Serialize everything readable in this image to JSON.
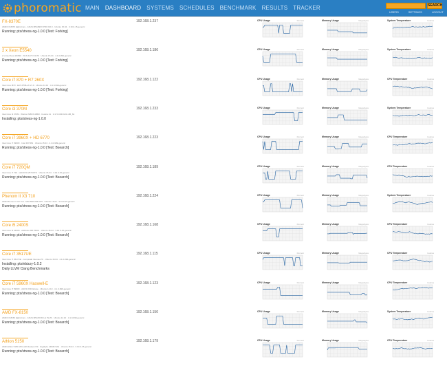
{
  "header": {
    "logo_text": "phoromatic",
    "nav": [
      "MAIN",
      "DASHBOARD",
      "SYSTEMS",
      "SCHEDULES",
      "BENCHMARK",
      "RESULTS",
      "TRACKER"
    ],
    "active_nav": "DASHBOARD",
    "search_button": "SEARCH",
    "user_links": [
      "USERS",
      "SETTINGS",
      "LOGOUT"
    ]
  },
  "graph_titles": [
    "CPU Usage",
    "Memory Usage",
    "System Temperature"
  ],
  "graph_titles_alt": [
    "CPU Usage",
    "Memory Usage",
    "CPU Temperature"
  ],
  "graph_units": [
    "Percent",
    "Megabytes",
    "Celsius"
  ],
  "systems": [
    {
      "name": "FX-8370E",
      "spec": "AMD FX-8370 Eight-Core · ASUS M5A99FX PRO R2.0 · Ubuntu 15.04 · 3.19.0-15-generic",
      "status": "Running: pts/stress-ng-1.0.0 [Test: Forking]",
      "status2": "",
      "ip": "192.168.1.237",
      "temp_title": "System Temperature"
    },
    {
      "name": "2 x Xeon E5540",
      "spec": "2 x Intel Xeon E5540 · SUN 4170 X4170 · Ubuntu 15.04 · 4.1.0-999-generic",
      "status": "Running: pts/stress-ng-1.0.0 [Test: Forking]",
      "status2": "",
      "ip": "192.168.1.186",
      "temp_title": "System Temperature"
    },
    {
      "name": "Core i7 870 + R7 260X",
      "spec": "Intel Core i870 · ECS P55H-A V1.0 · Ubuntu 14.10 · 4.1.0-999-generic",
      "status": "Running: pts/stress-ng-1.0.0 [Test: Forking]",
      "status2": "",
      "ip": "192.168.1.122",
      "temp_title": "CPU Temperature"
    },
    {
      "name": "Core i3 370M",
      "spec": "Intel Core i3 370M · Wistron MBXX-MBM · Fedora 21 · 3.17.8-300.fc21.x86_64",
      "status": "Installing: pts/stress-ng-1.0.0",
      "status2": "",
      "ip": "192.168.1.233",
      "temp_title": "System Temperature"
    },
    {
      "name": "Core i7 3960X + HD 6770",
      "spec": "Intel Core i7 3960X · Intel DX79SI · Ubuntu 15.04 · 4.1.0-999-generic",
      "status": "Running: pts/stress-ng-1.0.0 [Test: Bsearch]",
      "status2": "",
      "ip": "192.168.1.223",
      "temp_title": "CPU Temperature"
    },
    {
      "name": "Core i7 720QM",
      "spec": "Intel Core i7 720 · LENOVO 2574CTO · Ubuntu 15.04 · 3.19.0-15-generic",
      "status": "Running: pts/stress-ng-1.0.0 [Test: Bsearch]",
      "status2": "",
      "ip": "192.168.1.189",
      "temp_title": "CPU Temperature"
    },
    {
      "name": "Phenom II X3 710",
      "spec": "AMD Phenom II X3 710 · MSI 890GXM-G65 · Ubuntu 15.04 · 3.19.0-15-generic",
      "status": "Running: pts/stress-ng-1.0.0 [Test: Bsearch]",
      "status2": "",
      "ip": "192.168.1.224",
      "temp_title": "System Temperature"
    },
    {
      "name": "Core i5 2400S",
      "spec": "Intel Core i5 2400S · ASRock Z68 PRO3 · Ubuntu 15.04 · 3.19.0-15-generic",
      "status": "Running: pts/stress-ng-1.0.0 [Test: Bsearch]",
      "status2": "",
      "ip": "192.168.1.168",
      "temp_title": "CPU Temperature"
    },
    {
      "name": "Core i7 3517UE",
      "spec": "Intel Core i7 3517UE · Compulab Intense-PC · Ubuntu 15.04 · 4.1.0-999-generic",
      "status": "Installing: pts/ebizzy-1.0.2",
      "status2": "Daily LLVM Clang Benchmarks",
      "ip": "192.168.1.115",
      "temp_title": "CPU Temperature"
    },
    {
      "name": "Core i7 5960X Haswell-E",
      "spec": "Intel Core i7 5960X · ASUS X99 Deluxe · Ubuntu 14.10 · 4.1.0-999-generic",
      "status": "Running: pts/stress-ng-1.0.0 [Test: Bsearch]",
      "status2": "",
      "ip": "192.168.1.123",
      "temp_title": "CPU Temperature"
    },
    {
      "name": "AMD FX-8150",
      "spec": "AMD FX-8150 Eight-Core · ASUS M5A 88-M LE PLUS · Ubuntu 14.10 · 4.1.0-999-generic",
      "status": "Running: pts/stress-ng-1.0.0 [Test: Bsearch]",
      "status2": "",
      "ip": "192.168.1.150",
      "temp_title": "System Temperature"
    },
    {
      "name": "Athlon 5150",
      "spec": "AMD Athlon 5150 APU with Radeon R3 · Gigabyte AM1M-S2H · Ubuntu 15.04 · 3.19.0-15-generic",
      "status": "Running: pts/stress-ng-1.0.0 [Test: Bsearch]",
      "status2": "",
      "ip": "192.168.1.179",
      "temp_title": "CPU Temperature"
    }
  ]
}
